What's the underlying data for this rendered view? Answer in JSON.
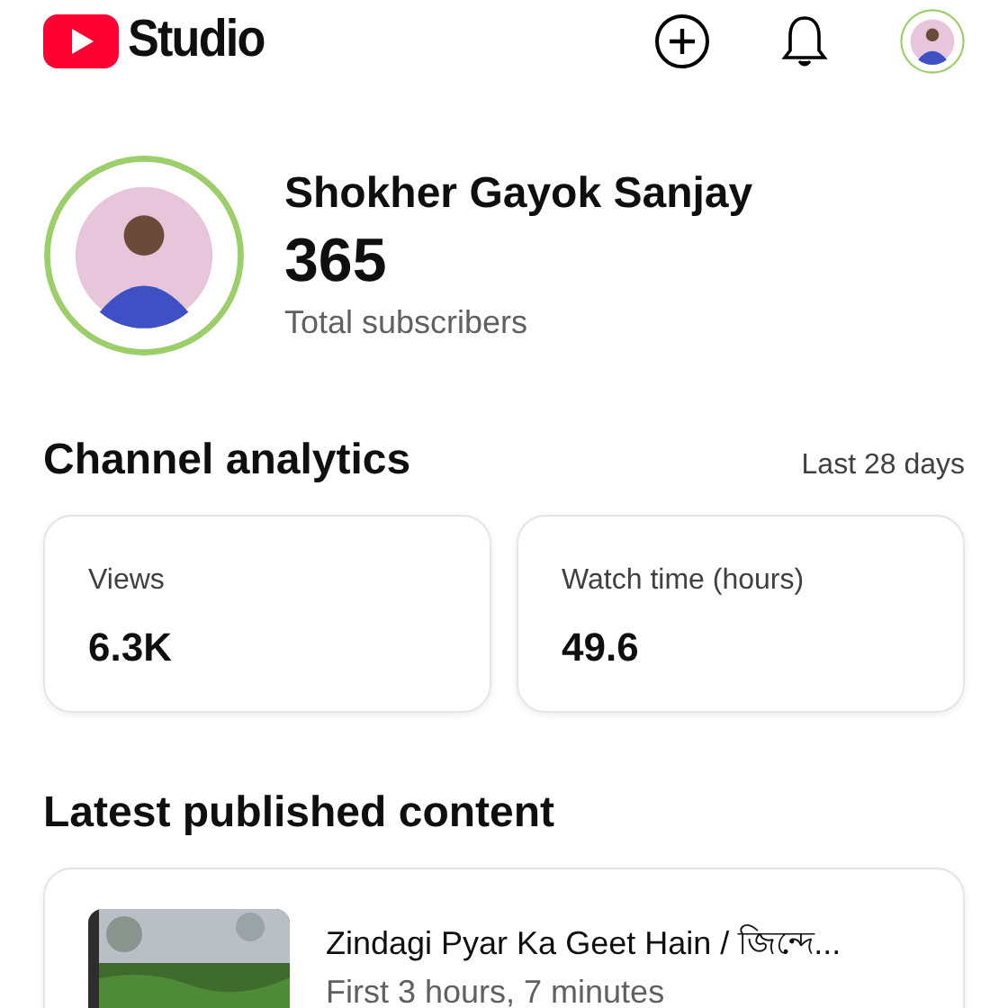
{
  "header": {
    "logo_text": "Studio"
  },
  "channel": {
    "name": "Shokher Gayok Sanjay",
    "subscribers": "365",
    "subscribers_label": "Total subscribers"
  },
  "analytics": {
    "title": "Channel analytics",
    "period": "Last 28 days",
    "cards": [
      {
        "label": "Views",
        "value": "6.3K"
      },
      {
        "label": "Watch time (hours)",
        "value": "49.6"
      }
    ]
  },
  "latest": {
    "title": "Latest published content",
    "items": [
      {
        "title": "Zindagi Pyar Ka Geet Hain / জিন্দে...",
        "subtitle": "First 3 hours, 7 minutes"
      }
    ]
  }
}
